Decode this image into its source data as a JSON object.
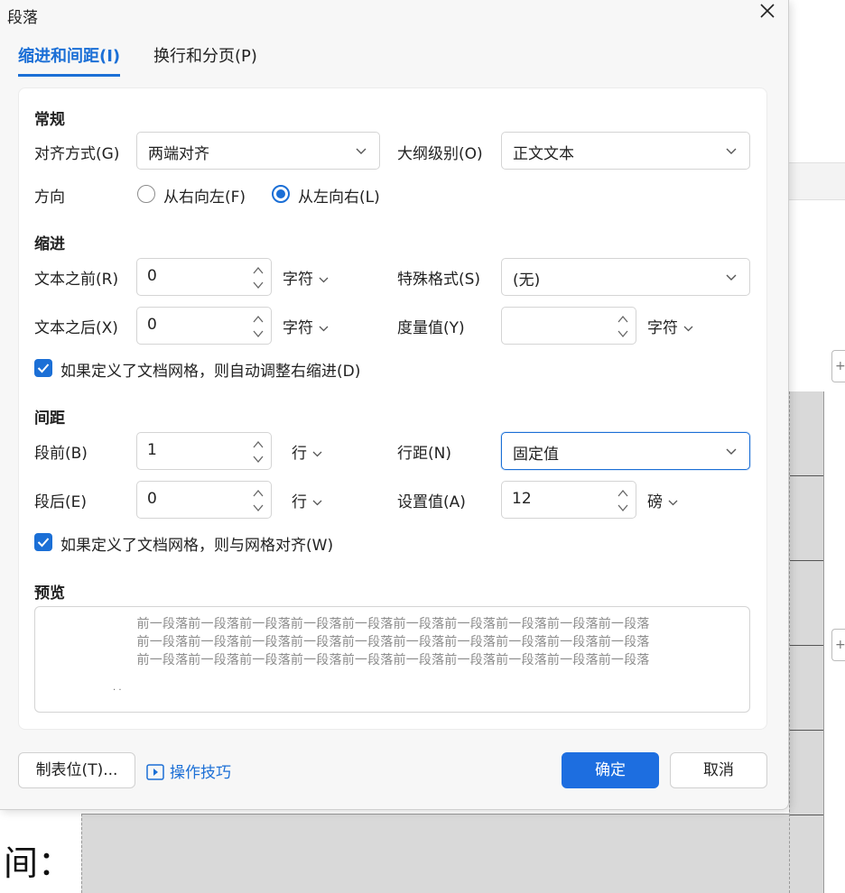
{
  "dialog": {
    "title": "段落"
  },
  "tabs": [
    {
      "label": "缩进和间距(I)",
      "active": true
    },
    {
      "label": "换行和分页(P)",
      "active": false
    }
  ],
  "general": {
    "heading": "常规",
    "alignment_label": "对齐方式(G)",
    "alignment_value": "两端对齐",
    "outline_label": "大纲级别(O)",
    "outline_value": "正文文本",
    "direction_label": "方向",
    "rtl_label": "从右向左(F)",
    "ltr_label": "从左向右(L)",
    "direction_selected": "ltr"
  },
  "indent": {
    "heading": "缩进",
    "before_label": "文本之前(R)",
    "before_value": "0",
    "before_unit": "字符",
    "after_label": "文本之后(X)",
    "after_value": "0",
    "after_unit": "字符",
    "special_label": "特殊格式(S)",
    "special_value": "(无)",
    "measure_label": "度量值(Y)",
    "measure_value": "",
    "measure_unit": "字符",
    "grid_checkbox_label": "如果定义了文档网格，则自动调整右缩进(D)",
    "grid_checkbox_checked": true
  },
  "spacing": {
    "heading": "间距",
    "before_label": "段前(B)",
    "before_value": "1",
    "before_unit": "行",
    "after_label": "段后(E)",
    "after_value": "0",
    "after_unit": "行",
    "line_label": "行距(N)",
    "line_value": "固定值",
    "setting_label": "设置值(A)",
    "setting_value": "12",
    "setting_unit": "磅",
    "grid_checkbox_label": "如果定义了文档网格，则与网格对齐(W)",
    "grid_checkbox_checked": true
  },
  "preview": {
    "heading": "预览",
    "lines": [
      "前一段落前一段落前一段落前一段落前一段落前一段落前一段落前一段落前一段落前一段落",
      "前一段落前一段落前一段落前一段落前一段落前一段落前一段落前一段落前一段落前一段落",
      "前一段落前一段落前一段落前一段落前一段落前一段落前一段落前一段落前一段落前一段落"
    ],
    "dots": ". ."
  },
  "footer": {
    "tabs_button": "制表位(T)...",
    "tips_link": "操作技巧",
    "ok_button": "确定",
    "cancel_button": "取消"
  },
  "background": {
    "bottom_text": "间：",
    "side_button_1": "+",
    "side_button_2": "+"
  },
  "colors": {
    "accent": "#1b6fd6",
    "primary_button": "#1d6ee0"
  }
}
